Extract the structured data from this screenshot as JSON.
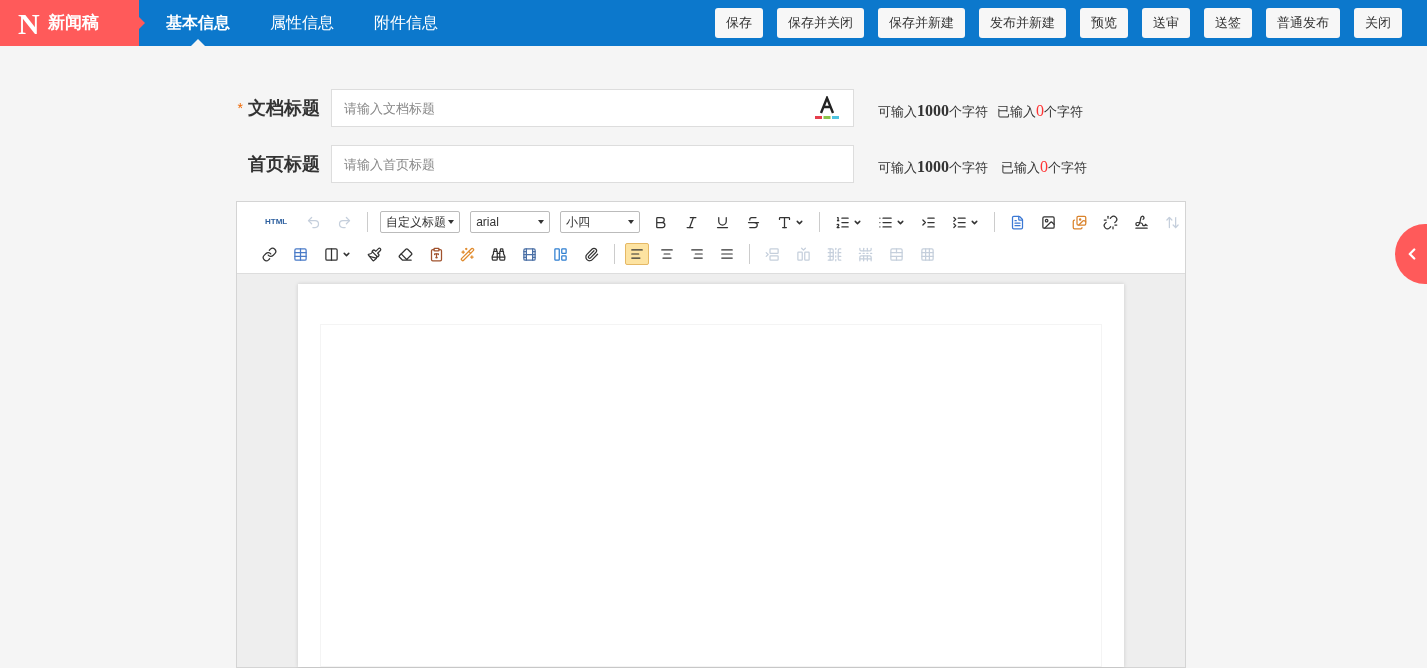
{
  "app": {
    "logo": "N",
    "title": "新闻稿"
  },
  "tabs": [
    {
      "label": "基本信息",
      "selected": true
    },
    {
      "label": "属性信息",
      "selected": false
    },
    {
      "label": "附件信息",
      "selected": false
    }
  ],
  "actions": [
    "保存",
    "保存并关闭",
    "保存并新建",
    "发布并新建",
    "预览",
    "送审",
    "送签",
    "普通发布",
    "关闭"
  ],
  "fields": [
    {
      "label": "文档标题",
      "required_mark": "*",
      "placeholder": "请输入文档标题",
      "color_picker": true,
      "limit": {
        "prefix": "可输入",
        "max": "1000",
        "suffix": "个字符"
      },
      "entered": {
        "prefix": "已输入",
        "count": "0",
        "suffix": "个字符"
      }
    },
    {
      "label": "首页标题",
      "placeholder": "请输入首页标题",
      "color_picker": false,
      "limit": {
        "prefix": "可输入",
        "max": "1000",
        "suffix": "个字符"
      },
      "entered": {
        "prefix": "已输入",
        "count": "0",
        "suffix": "个字符"
      }
    }
  ],
  "toolbar": {
    "rows": [
      [
        {
          "kind": "text",
          "label": "HTML"
        },
        {
          "kind": "icon",
          "disabled": true
        },
        {
          "kind": "icon",
          "disabled": true
        },
        {
          "kind": "sep"
        },
        {
          "kind": "select",
          "value": "自定义标题"
        },
        {
          "kind": "select",
          "value": "arial"
        },
        {
          "kind": "select",
          "value": "小四"
        },
        {
          "kind": "icon",
          "disabled": false
        },
        {
          "kind": "icon",
          "disabled": false
        },
        {
          "kind": "icon",
          "disabled": false
        },
        {
          "kind": "icon",
          "disabled": false
        },
        {
          "kind": "icon",
          "disabled": false,
          "caret": true
        },
        {
          "kind": "sep"
        },
        {
          "kind": "icon",
          "disabled": false,
          "caret": true
        },
        {
          "kind": "icon",
          "disabled": false,
          "caret": true
        },
        {
          "kind": "icon",
          "disabled": false
        },
        {
          "kind": "icon",
          "disabled": false,
          "caret": true
        },
        {
          "kind": "sep"
        },
        {
          "kind": "icon",
          "disabled": false
        },
        {
          "kind": "icon",
          "disabled": false
        },
        {
          "kind": "icon",
          "disabled": false
        },
        {
          "kind": "icon",
          "disabled": false
        },
        {
          "kind": "icon",
          "disabled": false
        },
        {
          "kind": "icon",
          "disabled": true
        }
      ],
      [
        {
          "kind": "icon",
          "disabled": false
        },
        {
          "kind": "icon",
          "disabled": false
        },
        {
          "kind": "icon",
          "disabled": false,
          "caret": true
        },
        {
          "kind": "icon",
          "disabled": false
        },
        {
          "kind": "icon",
          "disabled": false
        },
        {
          "kind": "icon",
          "disabled": false
        },
        {
          "kind": "icon",
          "disabled": false
        },
        {
          "kind": "icon",
          "disabled": false
        },
        {
          "kind": "icon",
          "disabled": false
        },
        {
          "kind": "icon",
          "disabled": false
        },
        {
          "kind": "icon",
          "disabled": false
        },
        {
          "kind": "sep"
        },
        {
          "kind": "align",
          "selected": true
        },
        {
          "kind": "align",
          "selected": false
        },
        {
          "kind": "align",
          "selected": false
        },
        {
          "kind": "align",
          "selected": false
        },
        {
          "kind": "sep"
        },
        {
          "kind": "icon",
          "disabled": true
        },
        {
          "kind": "icon",
          "disabled": true
        },
        {
          "kind": "icon",
          "disabled": true
        },
        {
          "kind": "icon",
          "disabled": true
        },
        {
          "kind": "icon",
          "disabled": true
        },
        {
          "kind": "icon",
          "disabled": true
        }
      ]
    ]
  }
}
